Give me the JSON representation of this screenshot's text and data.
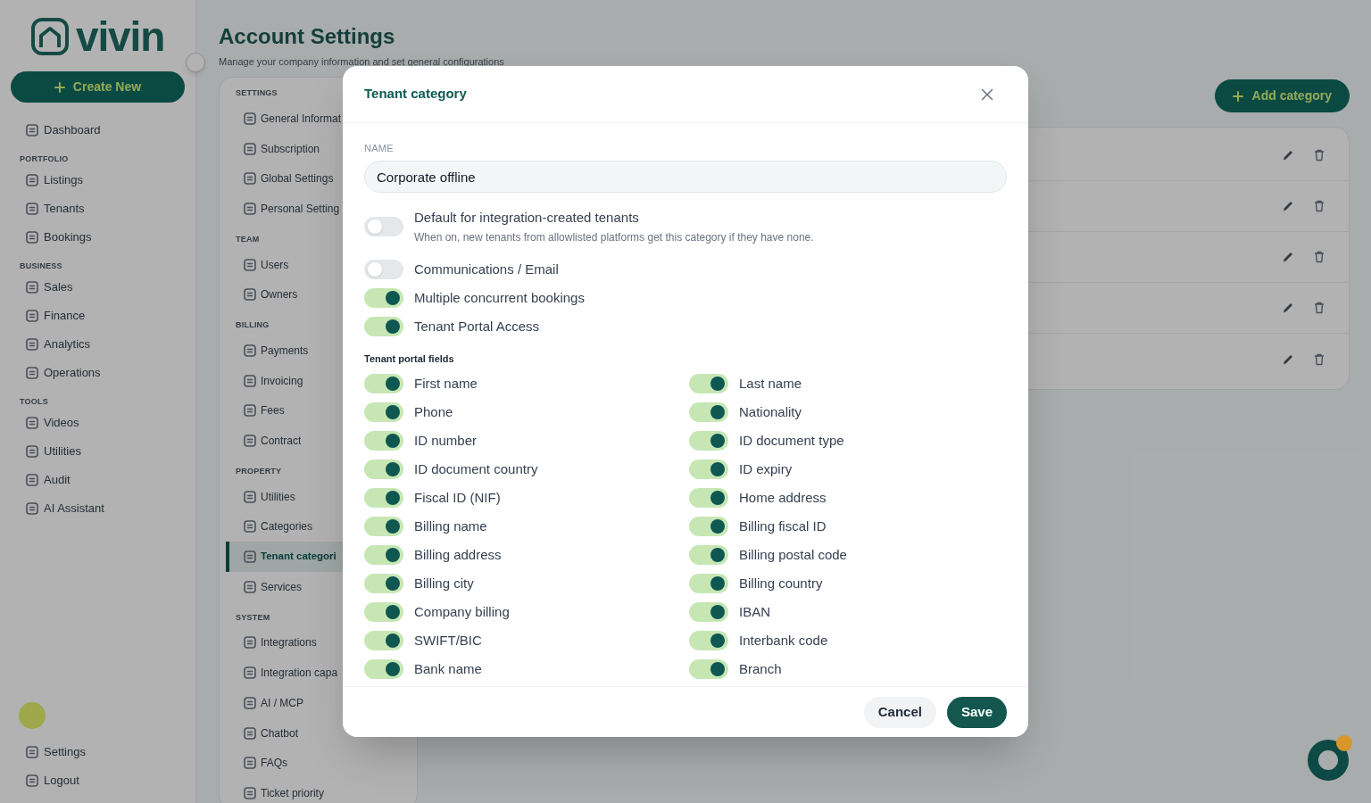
{
  "sidebar": {
    "logo": "vivin",
    "create_button": "Create New",
    "items": [
      {
        "kind": "link",
        "label": "Dashboard"
      },
      {
        "kind": "heading",
        "label": "PORTFOLIO"
      },
      {
        "kind": "link",
        "label": "Listings"
      },
      {
        "kind": "link",
        "label": "Tenants"
      },
      {
        "kind": "link",
        "label": "Bookings"
      },
      {
        "kind": "heading",
        "label": "BUSINESS"
      },
      {
        "kind": "link",
        "label": "Sales"
      },
      {
        "kind": "link",
        "label": "Finance"
      },
      {
        "kind": "link",
        "label": "Analytics"
      },
      {
        "kind": "link",
        "label": "Operations"
      },
      {
        "kind": "heading",
        "label": "TOOLS"
      },
      {
        "kind": "link",
        "label": "Videos"
      },
      {
        "kind": "link",
        "label": "Utilities"
      },
      {
        "kind": "link",
        "label": "Audit"
      },
      {
        "kind": "link",
        "label": "AI Assistant"
      }
    ],
    "footer_items": [
      "Settings",
      "Logout"
    ]
  },
  "page": {
    "title": "Account Settings",
    "subtitle": "Manage your company information and set general configurations",
    "add_button": "Add category"
  },
  "settings_nav": [
    {
      "heading": "SETTINGS",
      "items": [
        {
          "label": "General Informat",
          "selected": false
        },
        {
          "label": "Subscription",
          "selected": false
        },
        {
          "label": "Global Settings",
          "selected": false
        },
        {
          "label": "Personal Setting",
          "selected": false
        }
      ]
    },
    {
      "heading": "TEAM",
      "items": [
        {
          "label": "Users",
          "selected": false
        },
        {
          "label": "Owners",
          "selected": false
        }
      ]
    },
    {
      "heading": "BILLING",
      "items": [
        {
          "label": "Payments",
          "selected": false
        },
        {
          "label": "Invoicing",
          "selected": false
        },
        {
          "label": "Fees",
          "selected": false
        },
        {
          "label": "Contract",
          "selected": false
        }
      ]
    },
    {
      "heading": "PROPERTY",
      "items": [
        {
          "label": "Utilities",
          "selected": false
        },
        {
          "label": "Categories",
          "selected": false
        },
        {
          "label": "Tenant categori",
          "selected": true
        },
        {
          "label": "Services",
          "selected": false
        }
      ]
    },
    {
      "heading": "SYSTEM",
      "items": [
        {
          "label": "Integrations",
          "selected": false
        },
        {
          "label": "Integration capa",
          "selected": false
        },
        {
          "label": "AI / MCP",
          "selected": false
        },
        {
          "label": "Chatbot",
          "selected": false
        },
        {
          "label": "FAQs",
          "selected": false
        },
        {
          "label": "Ticket priority",
          "selected": false
        }
      ]
    }
  ],
  "modal": {
    "title": "Tenant category",
    "name_field": {
      "label": "NAME",
      "value": "Corporate offline"
    },
    "options": [
      {
        "label": "Default for integration-created tenants",
        "description": "When on, new tenants from allowlisted platforms get this category if they have none.",
        "on": false
      },
      {
        "label": "Communications / Email",
        "on": false
      },
      {
        "label": "Multiple concurrent bookings",
        "on": true
      },
      {
        "label": "Tenant Portal Access",
        "on": true
      }
    ],
    "fields_heading": "Tenant portal fields",
    "fields": [
      {
        "label": "First name",
        "on": true
      },
      {
        "label": "Last name",
        "on": true
      },
      {
        "label": "Phone",
        "on": true
      },
      {
        "label": "Nationality",
        "on": true
      },
      {
        "label": "ID number",
        "on": true
      },
      {
        "label": "ID document type",
        "on": true
      },
      {
        "label": "ID document country",
        "on": true
      },
      {
        "label": "ID expiry",
        "on": true
      },
      {
        "label": "Fiscal ID (NIF)",
        "on": true
      },
      {
        "label": "Home address",
        "on": true
      },
      {
        "label": "Billing name",
        "on": true
      },
      {
        "label": "Billing fiscal ID",
        "on": true
      },
      {
        "label": "Billing address",
        "on": true
      },
      {
        "label": "Billing postal code",
        "on": true
      },
      {
        "label": "Billing city",
        "on": true
      },
      {
        "label": "Billing country",
        "on": true
      },
      {
        "label": "Company billing",
        "on": true
      },
      {
        "label": "IBAN",
        "on": true
      },
      {
        "label": "SWIFT/BIC",
        "on": true
      },
      {
        "label": "Interbank code",
        "on": true
      },
      {
        "label": "Bank name",
        "on": true
      },
      {
        "label": "Branch",
        "on": true
      }
    ],
    "buttons": {
      "cancel": "Cancel",
      "save": "Save"
    }
  }
}
